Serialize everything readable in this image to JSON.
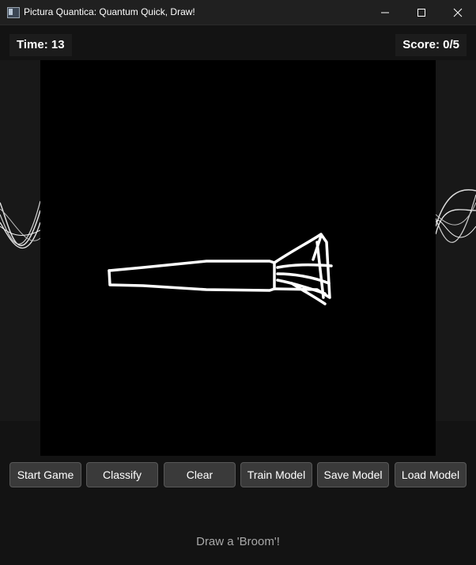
{
  "window": {
    "title": "Pictura Quantica: Quantum Quick, Draw!",
    "controls": [
      "minimize-icon",
      "maximize-icon",
      "close-icon"
    ]
  },
  "hud": {
    "time": "Time: 13",
    "score": "Score: 0/5"
  },
  "toolbar": {
    "buttons": [
      {
        "label": "Start Game"
      },
      {
        "label": "Classify"
      },
      {
        "label": "Clear"
      },
      {
        "label": "Train Model"
      },
      {
        "label": "Save Model"
      },
      {
        "label": "Load Model"
      }
    ]
  },
  "status": {
    "prompt": "Draw a 'Broom'!"
  },
  "colors": {
    "background": "#131313",
    "canvas": "#000000",
    "stroke": "#ffffff",
    "button": "#3a3a3a"
  }
}
